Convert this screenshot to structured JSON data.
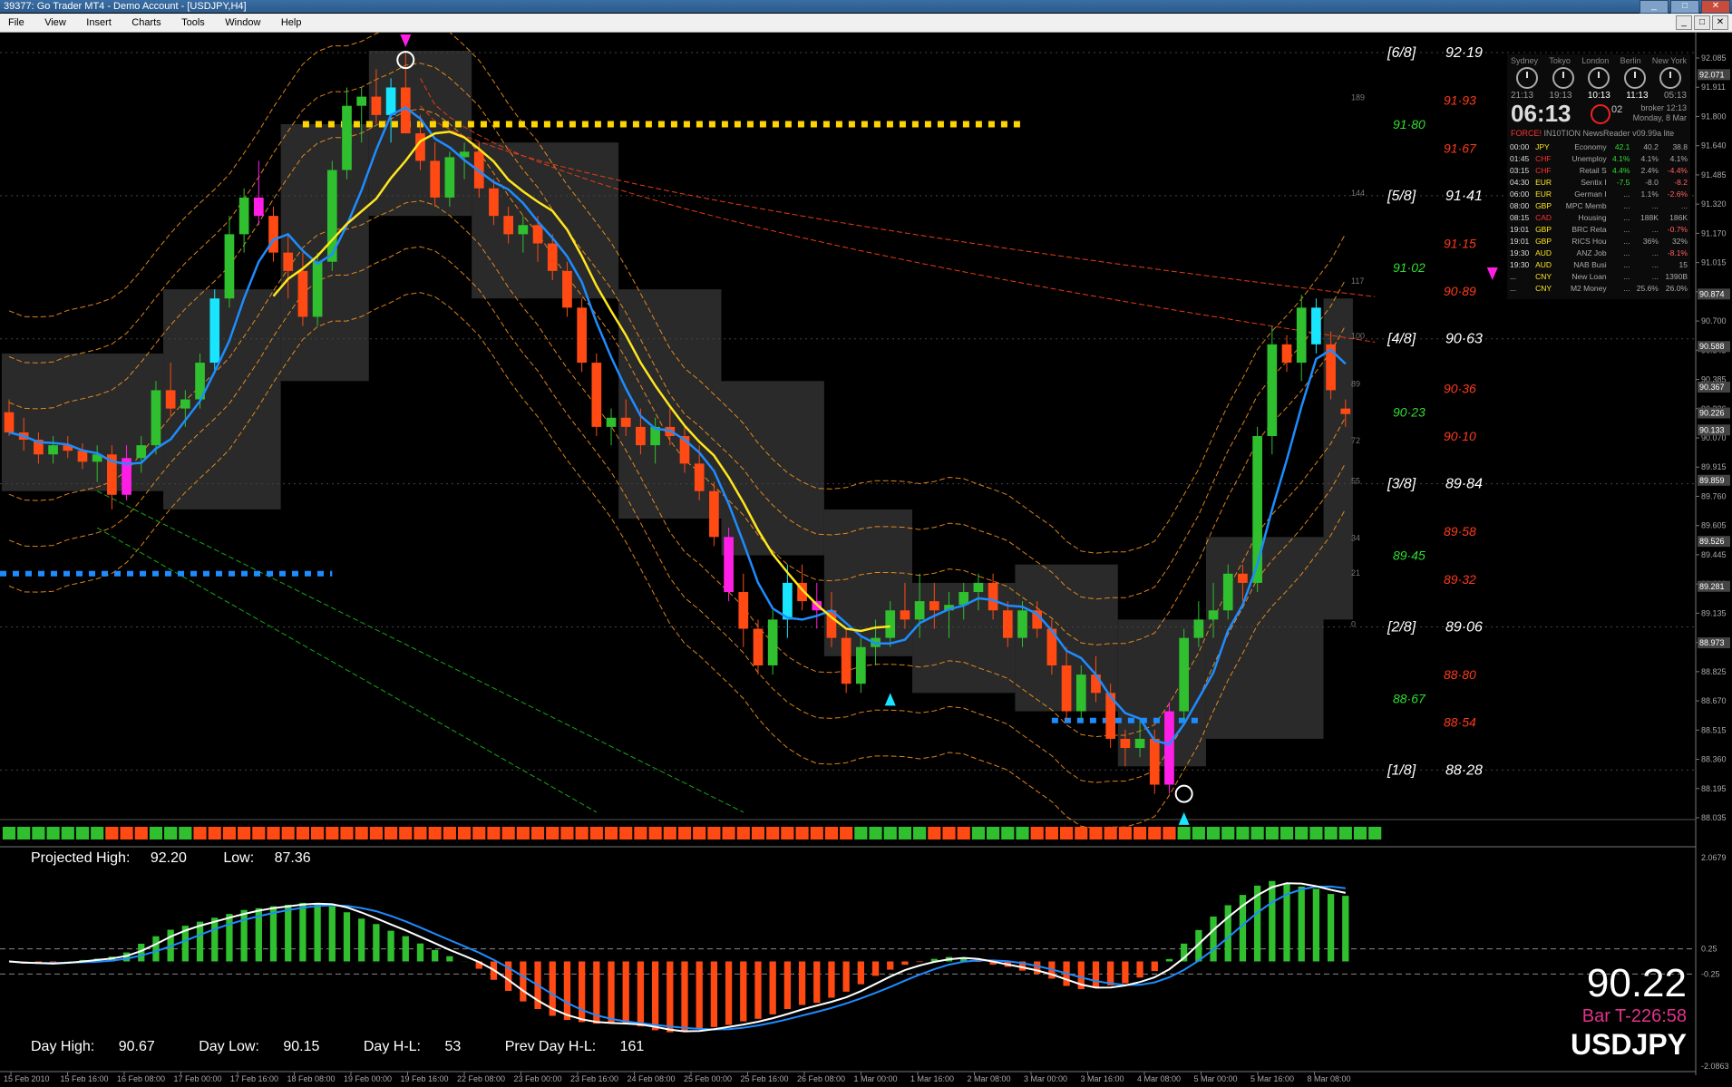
{
  "window": {
    "title": "39377: Go Trader MT4 - Demo Account - [USDJPY,H4]",
    "minimize": "_",
    "maximize": "□",
    "close": "✕"
  },
  "menu": {
    "items": [
      "File",
      "View",
      "Insert",
      "Charts",
      "Tools",
      "Window",
      "Help"
    ]
  },
  "mdi_buttons": [
    "_",
    "□",
    "✕"
  ],
  "clock": {
    "cities": [
      "Sydney",
      "Tokyo",
      "London",
      "Berlin",
      "New York"
    ],
    "times": [
      "21:13",
      "19:13",
      "10:13",
      "11:13",
      "05:13"
    ],
    "local_time": "06:13",
    "seconds": "02",
    "broker_label": "broker",
    "broker_time": "12:13",
    "date": "Monday, 8 Mar",
    "news_label": "FORCE!",
    "news_title": "IN10TION NewsReader v09.99a lite",
    "events": [
      [
        "00:00",
        "JPY",
        "Economy",
        "42.1",
        "40.2",
        "38.8"
      ],
      [
        "01:45",
        "CHF",
        "Unemploy",
        "4.1%",
        "4.1%",
        "4.1%"
      ],
      [
        "03:15",
        "CHF",
        "Retail S",
        "4.4%",
        "2.4%",
        "-4.4%"
      ],
      [
        "04:30",
        "EUR",
        "Sentix I",
        "-7.5",
        "-8.0",
        "-8.2"
      ],
      [
        "06:00",
        "EUR",
        "German I",
        "...",
        "1.1%",
        "-2.6%"
      ],
      [
        "08:00",
        "GBP",
        "MPC Memb",
        "...",
        "...",
        "..."
      ],
      [
        "08:15",
        "CAD",
        "Housing",
        "...",
        "188K",
        "186K"
      ],
      [
        "19:01",
        "GBP",
        "BRC Reta",
        "...",
        "...",
        "-0.7%"
      ],
      [
        "19:01",
        "GBP",
        "RICS Hou",
        "...",
        "36%",
        "32%"
      ],
      [
        "19:30",
        "AUD",
        "ANZ Job",
        "...",
        "...",
        "-8.1%"
      ],
      [
        "19:30",
        "AUD",
        "NAB Busi",
        "...",
        "...",
        "15"
      ],
      [
        "...",
        "CNY",
        "New Loan",
        "...",
        "...",
        "1390B"
      ],
      [
        "...",
        "CNY",
        "M2 Money",
        "...",
        "25.6%",
        "26.0%"
      ]
    ]
  },
  "colors": {
    "bull": "#2fbf2f",
    "bear": "#ff4a14",
    "cyan": "#19e5ff",
    "magenta": "#ff1ee6",
    "yellow": "#ffe61e",
    "blue": "#1e8cff",
    "orange_band": "#ff9a1e",
    "red_band": "#e63c14",
    "green_band": "#17a817",
    "box": "#2a2a2a"
  },
  "murrey": [
    {
      "label": "[6/8]",
      "price": "92·19"
    },
    {
      "label": "[5/8]",
      "price": "91·41"
    },
    {
      "label": "[4/8]",
      "price": "90·63"
    },
    {
      "label": "[3/8]",
      "price": "89·84"
    },
    {
      "label": "[2/8]",
      "price": "89·06"
    },
    {
      "label": "[1/8]",
      "price": "88·28"
    }
  ],
  "fib_levels": [
    {
      "price": "91·93",
      "color": "red"
    },
    {
      "price": "91·80",
      "color": "green"
    },
    {
      "price": "91·67",
      "color": "red"
    },
    {
      "price": "91·15",
      "color": "red"
    },
    {
      "price": "91·02",
      "color": "green"
    },
    {
      "price": "90·89",
      "color": "red"
    },
    {
      "price": "90·36",
      "color": "red"
    },
    {
      "price": "90·23",
      "color": "green"
    },
    {
      "price": "90·10",
      "color": "red"
    },
    {
      "price": "89·58",
      "color": "red"
    },
    {
      "price": "89·45",
      "color": "green"
    },
    {
      "price": "89·32",
      "color": "red"
    },
    {
      "price": "88·80",
      "color": "red"
    },
    {
      "price": "88·67",
      "color": "green"
    },
    {
      "price": "88·54",
      "color": "red"
    }
  ],
  "grid_numbers": [
    "189",
    "144",
    "117",
    "100",
    "89",
    "72",
    "55",
    "34",
    "21",
    "0"
  ],
  "price_axis": [
    "92.085",
    "91.911",
    "91.800",
    "91.640",
    "91.485",
    "91.320",
    "91.170",
    "91.015",
    "90.870",
    "90.700",
    "90.545",
    "90.385",
    "90.226",
    "90.070",
    "89.915",
    "89.760",
    "89.605",
    "89.445",
    "89.290",
    "89.135",
    "88.980",
    "88.825",
    "88.670",
    "88.515",
    "88.360",
    "88.195",
    "88.035"
  ],
  "price_axis_highlight": [
    "92.071",
    "90.874",
    "90.588",
    "90.367",
    "90.226",
    "90.133",
    "89.859",
    "89.526",
    "89.281",
    "88.973"
  ],
  "time_axis": [
    "15 Feb 2010",
    "15 Feb 16:00",
    "16 Feb 08:00",
    "17 Feb 00:00",
    "17 Feb 16:00",
    "18 Feb 08:00",
    "19 Feb 00:00",
    "19 Feb 16:00",
    "22 Feb 08:00",
    "23 Feb 00:00",
    "23 Feb 16:00",
    "24 Feb 08:00",
    "25 Feb 00:00",
    "25 Feb 16:00",
    "26 Feb 08:00",
    "1 Mar 00:00",
    "1 Mar 16:00",
    "2 Mar 08:00",
    "3 Mar 00:00",
    "3 Mar 16:00",
    "4 Mar 08:00",
    "5 Mar 00:00",
    "5 Mar 16:00",
    "8 Mar 08:00"
  ],
  "osc_axis": [
    "2.0679",
    "0.25",
    "-0.25",
    "-2.0863"
  ],
  "projected": {
    "high_label": "Projected High:",
    "high": "92.20",
    "low_label": "Low:",
    "low": "87.36"
  },
  "day_stats": {
    "high_label": "Day High:",
    "high": "90.67",
    "low_label": "Day Low:",
    "low": "90.15",
    "hl_label": "Day H-L:",
    "hl": "53",
    "prev_label": "Prev Day H-L:",
    "prev": "161"
  },
  "current": {
    "price": "90.22",
    "bar_timer": "Bar T-226:58",
    "symbol": "USDJPY"
  },
  "chart_data": {
    "type": "candlestick",
    "symbol": "USDJPY",
    "timeframe": "H4",
    "ylim": [
      88.0,
      92.2
    ],
    "candles": [
      [
        90.23,
        90.3,
        90.1,
        90.12
      ],
      [
        90.12,
        90.2,
        90.02,
        90.08
      ],
      [
        90.08,
        90.12,
        89.95,
        90.0
      ],
      [
        90.0,
        90.1,
        89.95,
        90.05
      ],
      [
        90.05,
        90.1,
        89.98,
        90.02
      ],
      [
        90.02,
        90.06,
        89.92,
        89.96
      ],
      [
        89.96,
        90.05,
        89.85,
        90.0
      ],
      [
        90.0,
        90.05,
        89.7,
        89.78
      ],
      [
        89.78,
        90.05,
        89.75,
        89.98
      ],
      [
        89.98,
        90.1,
        89.9,
        90.05
      ],
      [
        90.05,
        90.4,
        90.0,
        90.35
      ],
      [
        90.35,
        90.5,
        90.2,
        90.25
      ],
      [
        90.25,
        90.35,
        90.15,
        90.3
      ],
      [
        90.3,
        90.55,
        90.25,
        90.5
      ],
      [
        90.5,
        90.9,
        90.45,
        90.85
      ],
      [
        90.85,
        91.3,
        90.8,
        91.2
      ],
      [
        91.2,
        91.45,
        91.1,
        91.4
      ],
      [
        91.4,
        91.6,
        91.25,
        91.3
      ],
      [
        91.3,
        91.35,
        91.05,
        91.1
      ],
      [
        91.1,
        91.2,
        90.85,
        91.0
      ],
      [
        91.0,
        91.1,
        90.7,
        90.75
      ],
      [
        90.75,
        91.1,
        90.7,
        91.05
      ],
      [
        91.05,
        91.6,
        91.0,
        91.55
      ],
      [
        91.55,
        92.0,
        91.5,
        91.9
      ],
      [
        91.9,
        92.0,
        91.7,
        91.95
      ],
      [
        91.95,
        92.1,
        91.8,
        91.85
      ],
      [
        91.85,
        92.05,
        91.7,
        92.0
      ],
      [
        92.0,
        92.2,
        91.8,
        91.75
      ],
      [
        91.75,
        91.85,
        91.55,
        91.6
      ],
      [
        91.6,
        91.7,
        91.35,
        91.4
      ],
      [
        91.4,
        91.65,
        91.35,
        91.62
      ],
      [
        91.62,
        91.7,
        91.5,
        91.65
      ],
      [
        91.65,
        91.7,
        91.4,
        91.45
      ],
      [
        91.45,
        91.5,
        91.25,
        91.3
      ],
      [
        91.3,
        91.35,
        91.15,
        91.2
      ],
      [
        91.2,
        91.3,
        91.1,
        91.25
      ],
      [
        91.25,
        91.3,
        91.05,
        91.15
      ],
      [
        91.15,
        91.2,
        90.95,
        91.0
      ],
      [
        91.0,
        91.05,
        90.75,
        90.8
      ],
      [
        90.8,
        90.85,
        90.45,
        90.5
      ],
      [
        90.5,
        90.55,
        90.1,
        90.15
      ],
      [
        90.15,
        90.25,
        90.05,
        90.2
      ],
      [
        90.2,
        90.3,
        90.1,
        90.15
      ],
      [
        90.15,
        90.25,
        90.0,
        90.05
      ],
      [
        90.05,
        90.2,
        89.95,
        90.15
      ],
      [
        90.15,
        90.25,
        90.05,
        90.1
      ],
      [
        90.1,
        90.15,
        89.9,
        89.95
      ],
      [
        89.95,
        90.05,
        89.75,
        89.8
      ],
      [
        89.8,
        89.85,
        89.5,
        89.55
      ],
      [
        89.55,
        89.6,
        89.2,
        89.25
      ],
      [
        89.25,
        89.35,
        88.95,
        89.05
      ],
      [
        89.05,
        89.1,
        88.8,
        88.85
      ],
      [
        88.85,
        89.15,
        88.8,
        89.1
      ],
      [
        89.1,
        89.4,
        89.0,
        89.3
      ],
      [
        89.3,
        89.4,
        89.15,
        89.2
      ],
      [
        89.2,
        89.3,
        89.05,
        89.15
      ],
      [
        89.15,
        89.25,
        88.95,
        89.0
      ],
      [
        89.0,
        89.05,
        88.7,
        88.75
      ],
      [
        88.75,
        89.0,
        88.7,
        88.95
      ],
      [
        88.95,
        89.1,
        88.85,
        89.0
      ],
      [
        89.0,
        89.2,
        88.95,
        89.15
      ],
      [
        89.15,
        89.3,
        89.05,
        89.1
      ],
      [
        89.1,
        89.35,
        89.0,
        89.2
      ],
      [
        89.2,
        89.3,
        89.05,
        89.15
      ],
      [
        89.15,
        89.25,
        89.0,
        89.18
      ],
      [
        89.18,
        89.3,
        89.1,
        89.25
      ],
      [
        89.25,
        89.35,
        89.15,
        89.3
      ],
      [
        89.3,
        89.35,
        89.1,
        89.15
      ],
      [
        89.15,
        89.2,
        88.95,
        89.0
      ],
      [
        89.0,
        89.2,
        88.95,
        89.15
      ],
      [
        89.15,
        89.2,
        89.0,
        89.05
      ],
      [
        89.05,
        89.1,
        88.8,
        88.85
      ],
      [
        88.85,
        88.95,
        88.55,
        88.6
      ],
      [
        88.6,
        88.85,
        88.55,
        88.8
      ],
      [
        88.8,
        88.9,
        88.65,
        88.7
      ],
      [
        88.7,
        88.75,
        88.4,
        88.45
      ],
      [
        88.45,
        88.5,
        88.3,
        88.4
      ],
      [
        88.4,
        88.55,
        88.35,
        88.45
      ],
      [
        88.45,
        88.5,
        88.15,
        88.2
      ],
      [
        88.2,
        88.65,
        88.15,
        88.6
      ],
      [
        88.6,
        89.05,
        88.55,
        89.0
      ],
      [
        89.0,
        89.2,
        88.95,
        89.1
      ],
      [
        89.1,
        89.3,
        89.0,
        89.15
      ],
      [
        89.15,
        89.4,
        89.1,
        89.35
      ],
      [
        89.35,
        89.4,
        89.2,
        89.3
      ],
      [
        89.3,
        90.15,
        89.25,
        90.1
      ],
      [
        90.1,
        90.7,
        90.0,
        90.6
      ],
      [
        90.6,
        90.65,
        90.45,
        90.5
      ],
      [
        90.5,
        90.87,
        90.4,
        90.8
      ],
      [
        90.8,
        90.85,
        90.55,
        90.6
      ],
      [
        90.6,
        90.67,
        90.3,
        90.35
      ],
      [
        90.25,
        90.3,
        90.15,
        90.22
      ]
    ],
    "fast_ma_label": "blue",
    "slow_ma_label": "yellow",
    "oscillator": {
      "type": "histogram",
      "ylim": [
        -2.0863,
        2.0679
      ]
    }
  }
}
